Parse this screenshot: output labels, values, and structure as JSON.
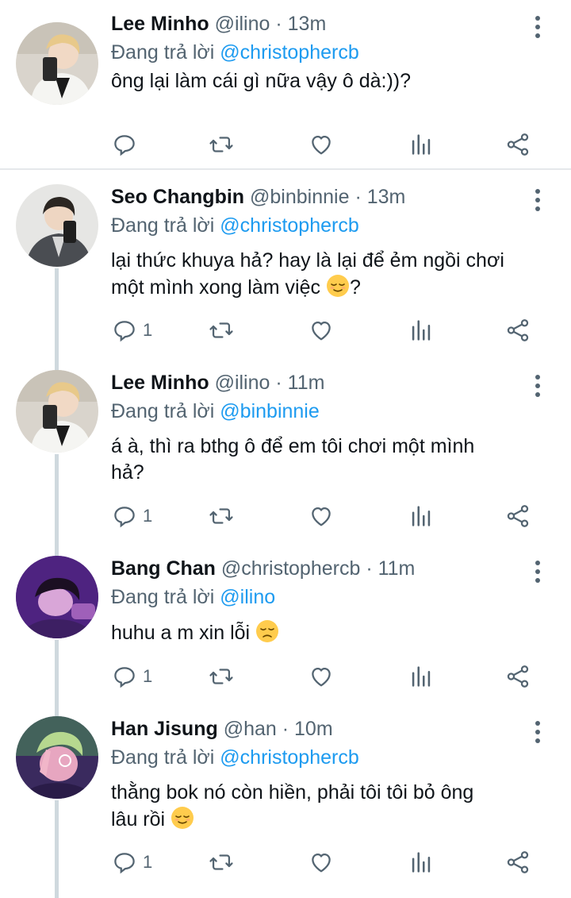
{
  "reply_prefix": "Đang trả lời",
  "tweets": [
    {
      "name": "Lee Minho",
      "handle": "@ilino",
      "time": "13m",
      "reply_to": "@christophercb",
      "text": "ông lại làm cái gì nữa vậy ô dà:))?",
      "reply_count": ""
    },
    {
      "name": "Seo Changbin",
      "handle": "@binbinnie",
      "time": "13m",
      "reply_to": "@christophercb",
      "text_line1": "lại thức khuya hả? hay là lại để ẻm ngồi chơi",
      "text_line2": "một mình xong làm việc ",
      "text_suffix": "?",
      "reply_count": "1"
    },
    {
      "name": "Lee Minho",
      "handle": "@ilino",
      "time": "11m",
      "reply_to": "@binbinnie",
      "text_line1": "á à, thì ra bthg ô để em tôi chơi một mình",
      "text_line2": "hả?",
      "reply_count": "1"
    },
    {
      "name": "Bang Chan",
      "handle": "@christophercb",
      "time": "11m",
      "reply_to": "@ilino",
      "text": "huhu a m xin lỗi ",
      "reply_count": "1"
    },
    {
      "name": "Han Jisung",
      "handle": "@han",
      "time": "10m",
      "reply_to": "@christophercb",
      "text_line1": "thằng bok nó còn hiền, phải tôi tôi bỏ ông",
      "text_line2": "lâu rồi ",
      "reply_count": "1"
    }
  ],
  "colors": {
    "link": "#1d9bf0",
    "secondary_text": "#536471",
    "thread_line": "#cfd9de"
  }
}
